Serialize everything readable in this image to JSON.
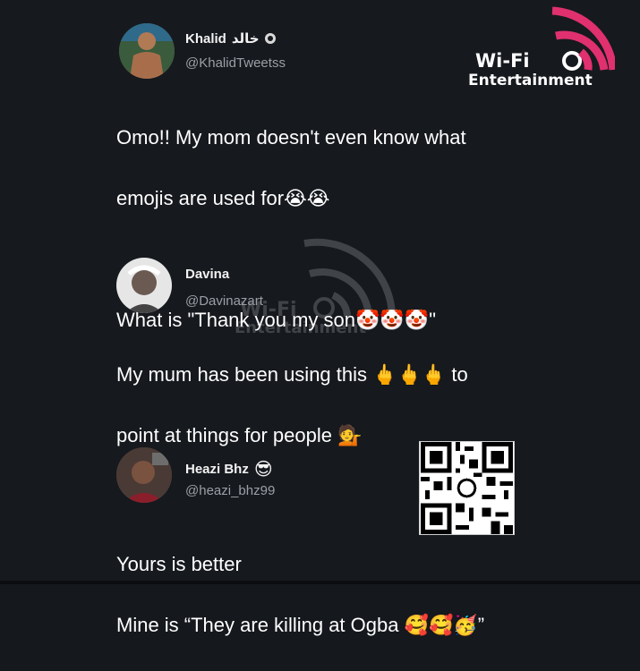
{
  "logo": {
    "line1": "Wi-Fi",
    "line2": "Entertainment",
    "accent": "#e0306e"
  },
  "watermark": {
    "line1": "Wi-Fi",
    "line2": "Entertainment"
  },
  "tweets": [
    {
      "name": "Khalid",
      "name_arabic": "خالد",
      "handle": "@KhalidTweetss",
      "lines": [
        "Omo!! My mom doesn't even know what",
        "emojis are used for😭😭",
        "",
        "What is \"Thank you my son🤡🤡🤡\""
      ]
    },
    {
      "name": "Davina",
      "handle": "@Davinazart",
      "lines": [
        "My mum has been using this 🖕🖕🖕 to",
        "point at things for people 💁"
      ]
    },
    {
      "name": "Heazi Bhz",
      "name_emoji": "😎",
      "handle": "@heazi_bhz99",
      "lines": [
        "Yours is better",
        "Mine is “They are killing at Ogba 🥰🥰🥳”"
      ]
    }
  ]
}
